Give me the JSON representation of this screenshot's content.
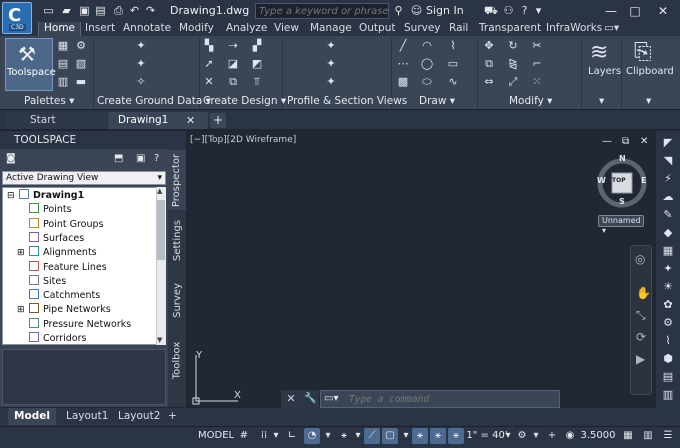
{
  "app": {
    "logo_letter": "C",
    "logo_tag": "C3D",
    "file_title": "Drawing1.dwg"
  },
  "search": {
    "placeholder": "Type a keyword or phrase"
  },
  "account": {
    "sign_in_label": "Sign In"
  },
  "ribbon_tabs": [
    "Home",
    "Insert",
    "Annotate",
    "Modify",
    "Analyze",
    "View",
    "Manage",
    "Output",
    "Survey",
    "Rail",
    "Transparent",
    "InfraWorks"
  ],
  "ribbon_panels": {
    "toolspace_label": "Toolspace",
    "palettes": "Palettes",
    "create_ground_data": "Create Ground Data",
    "create_design": "Create Design",
    "profile_section_views": "Profile & Section Views",
    "draw": "Draw",
    "modify": "Modify",
    "layers": "Layers",
    "clipboard": "Clipboard"
  },
  "doc_tabs": {
    "start": "Start",
    "drawing1": "Drawing1",
    "add": "+"
  },
  "toolspace": {
    "title": "TOOLSPACE",
    "view_selector": "Active Drawing View",
    "tree": [
      {
        "label": "Drawing1",
        "bold": true,
        "level": 0,
        "expander": "⊟",
        "icon": "drawing-icon"
      },
      {
        "label": "Points",
        "level": 1,
        "expander": "",
        "icon": "points-icon"
      },
      {
        "label": "Point Groups",
        "level": 1,
        "expander": "",
        "icon": "point-groups-icon"
      },
      {
        "label": "Surfaces",
        "level": 1,
        "expander": "",
        "icon": "surfaces-icon"
      },
      {
        "label": "Alignments",
        "level": 1,
        "expander": "⊞",
        "icon": "alignments-icon"
      },
      {
        "label": "Feature Lines",
        "level": 1,
        "expander": "",
        "icon": "feature-lines-icon"
      },
      {
        "label": "Sites",
        "level": 1,
        "expander": "",
        "icon": "sites-icon"
      },
      {
        "label": "Catchments",
        "level": 1,
        "expander": "",
        "icon": "catchments-icon"
      },
      {
        "label": "Pipe Networks",
        "level": 1,
        "expander": "⊞",
        "icon": "pipe-networks-icon"
      },
      {
        "label": "Pressure Networks",
        "level": 1,
        "expander": "",
        "icon": "pressure-networks-icon"
      },
      {
        "label": "Corridors",
        "level": 1,
        "expander": "",
        "icon": "corridors-icon"
      }
    ],
    "vertical_tabs": [
      "Prospector",
      "Settings",
      "Survey",
      "Toolbox"
    ]
  },
  "viewport": {
    "label": "[−][Top][2D Wireframe]",
    "compass": {
      "n": "N",
      "s": "S",
      "e": "E",
      "w": "W",
      "top": "TOP"
    },
    "ucs_name": "Unnamed",
    "axis_x": "X",
    "axis_y": "Y"
  },
  "command": {
    "placeholder": "Type a command"
  },
  "layout_tabs": [
    "Model",
    "Layout1",
    "Layout2"
  ],
  "status": {
    "model": "MODEL",
    "scale": "1\" = 40'",
    "value": "3.5000"
  },
  "colors": {
    "accent": "#4d6a90",
    "title_bg": "#2b3444",
    "ribbon_bg": "#3a4556",
    "canvas_bg": "#212833"
  }
}
